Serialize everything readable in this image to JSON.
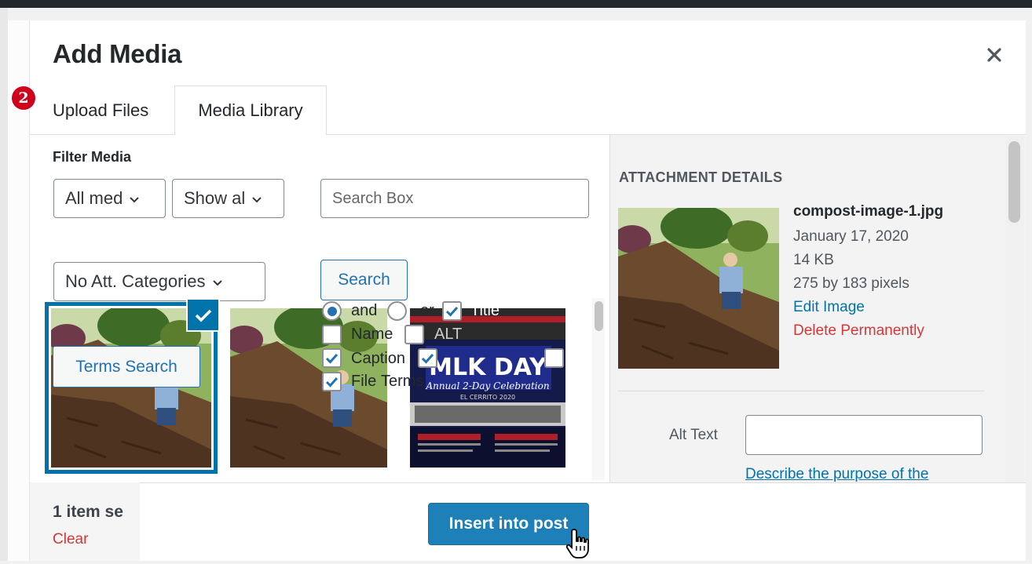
{
  "dialog": {
    "title": "Add Media",
    "close_icon": "close-icon",
    "step_badge": "2"
  },
  "tabs": [
    {
      "label": "Upload Files",
      "active": false
    },
    {
      "label": "Media Library",
      "active": true
    }
  ],
  "filters": {
    "label": "Filter Media",
    "media_type": "All med",
    "date": "Show al",
    "search_placeholder": "Search Box",
    "category": "No Att. Categories",
    "search_button": "Search"
  },
  "search_options": {
    "and": "and",
    "or": "or",
    "title": "Title",
    "name": "Name",
    "alt": "ALT",
    "caption": "Caption",
    "file": "File",
    "terms": "Terms"
  },
  "grid": {
    "terms_search_button": "Terms Search",
    "mlk_title": "MLK DAY",
    "mlk_subtitle": "Annual 2-Day Celebration",
    "mlk_location": "EL CERRITO 2020"
  },
  "attachment": {
    "heading": "ATTACHMENT DETAILS",
    "filename": "compost-image-1.jpg",
    "date": "January 17, 2020",
    "size": "14 KB",
    "dimensions": "275 by 183 pixels",
    "edit_link": "Edit Image",
    "delete_link": "Delete Permanently",
    "alt_label": "Alt Text",
    "alt_value": "",
    "alt_help_link": "Describe the purpose of the"
  },
  "footer": {
    "selection_count": "1 item se",
    "clear_link": "Clear",
    "insert_button": "Insert into post"
  },
  "colors": {
    "accent": "#0073aa",
    "danger": "#d63638",
    "badge": "#d0021b",
    "primary_button": "#1e80b8"
  }
}
